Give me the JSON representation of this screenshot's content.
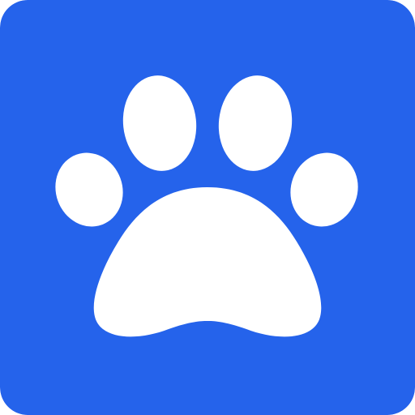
{
  "app_icon": {
    "icon": "paw-icon",
    "colors": {
      "background": "#2563EB",
      "glyph": "#FFFFFF"
    }
  }
}
